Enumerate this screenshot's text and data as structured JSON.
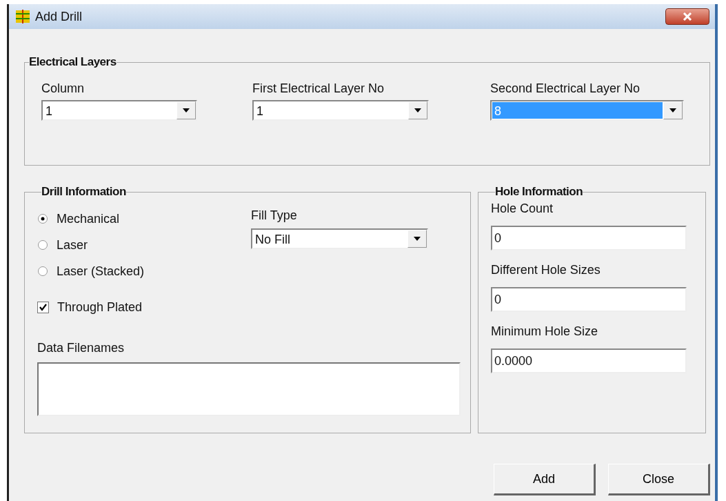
{
  "window": {
    "title": "Add Drill"
  },
  "electrical_layers": {
    "title": "Electrical Layers",
    "fields": [
      {
        "label": "Column",
        "value": "1",
        "highlighted": false
      },
      {
        "label": "First Electrical Layer No",
        "value": "1",
        "highlighted": false
      },
      {
        "label": "Second Electrical Layer No",
        "value": "8",
        "highlighted": true
      }
    ]
  },
  "drill_information": {
    "title": "Drill Information",
    "options": [
      {
        "label": "Mechanical",
        "selected": true
      },
      {
        "label": "Laser",
        "selected": false
      },
      {
        "label": "Laser (Stacked)",
        "selected": false
      }
    ],
    "through_plated": {
      "label": "Through Plated",
      "checked": true
    },
    "fill_type": {
      "label": "Fill Type",
      "value": "No Fill"
    },
    "data_filenames": {
      "label": "Data Filenames"
    }
  },
  "hole_information": {
    "title": "Hole Information",
    "fields": [
      {
        "label": "Hole Count",
        "value": "0"
      },
      {
        "label": "Different Hole Sizes",
        "value": "0"
      },
      {
        "label": "Minimum Hole Size",
        "value": "0.0000"
      }
    ]
  },
  "buttons": [
    "Add",
    "Close"
  ]
}
